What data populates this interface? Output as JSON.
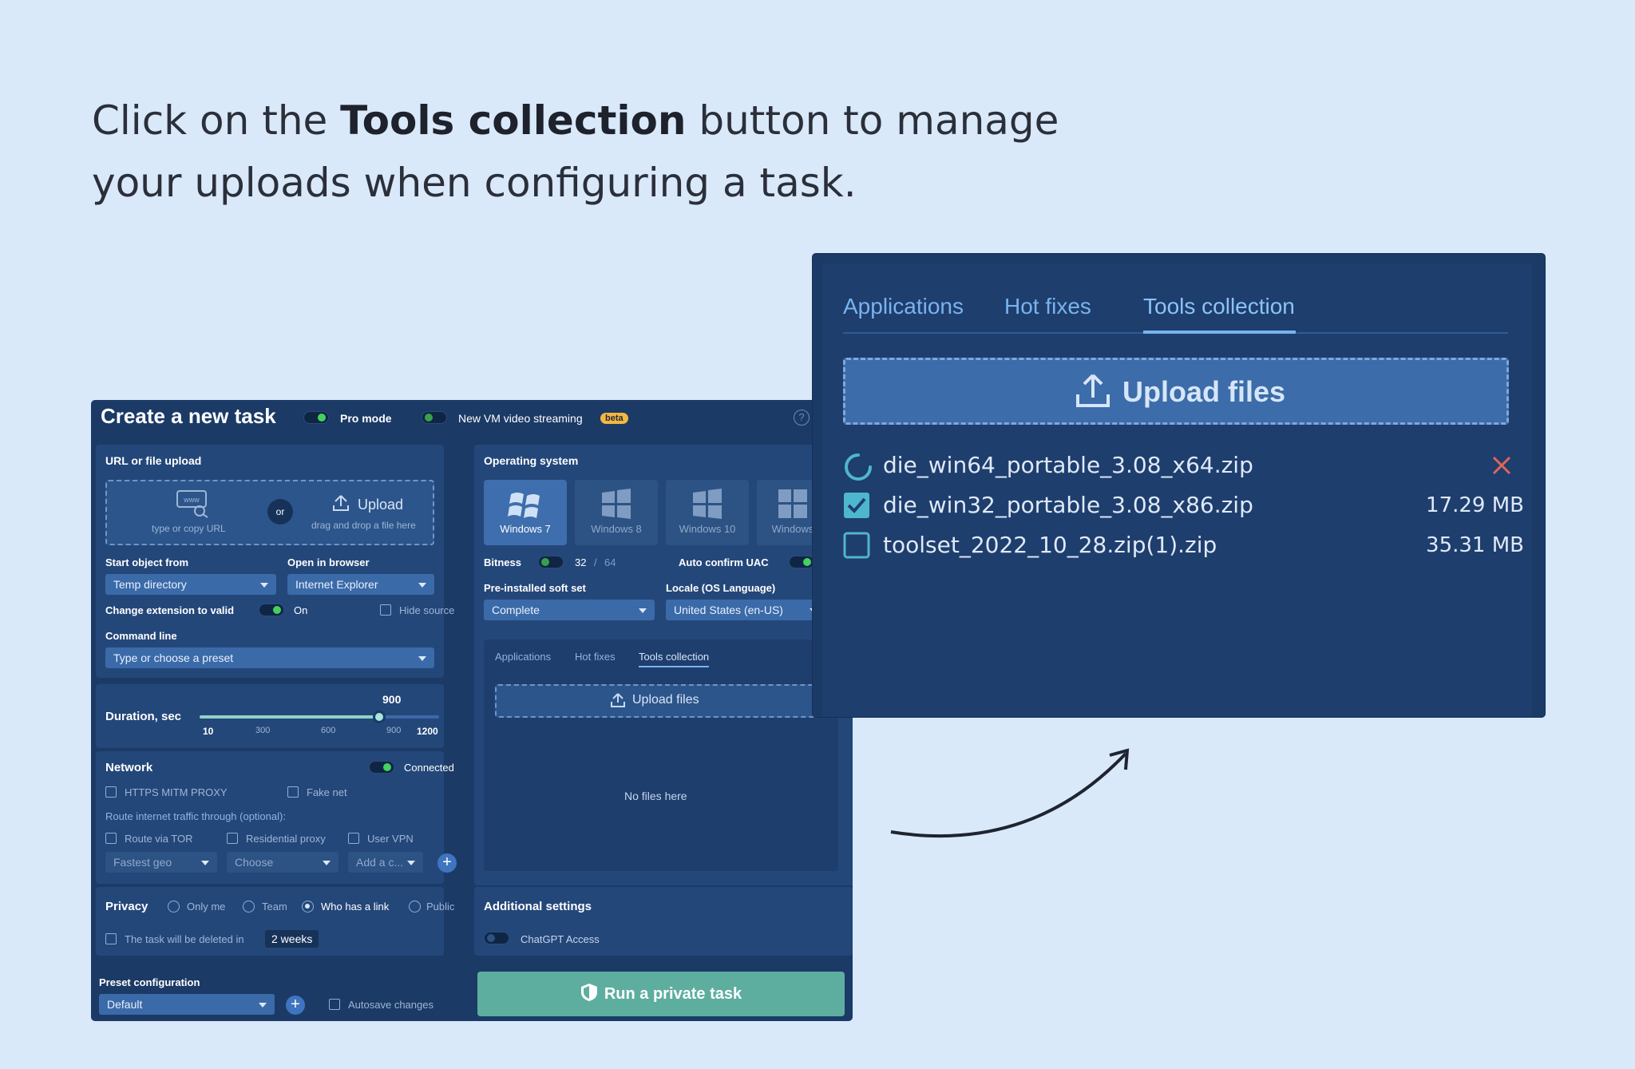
{
  "header": {
    "prefix": "Click on the ",
    "bold": "Tools collection",
    "line1_suffix": " button to manage",
    "line2": "your uploads when configuring a task."
  },
  "task": {
    "title": "Create a new task",
    "pro_mode": "Pro mode",
    "vm_streaming": "New VM video streaming",
    "beta": "beta",
    "help": "?"
  },
  "upload": {
    "section": "URL or file upload",
    "url_hint": "type or copy URL",
    "or": "or",
    "upload_label": "Upload",
    "upload_hint": "drag and drop a file here",
    "start_label": "Start object from",
    "start_value": "Temp directory",
    "browser_label": "Open in browser",
    "browser_value": "Internet Explorer",
    "change_ext": "Change extension to valid",
    "change_ext_state": "On",
    "hide_source": "Hide source",
    "cmd_label": "Command line",
    "cmd_placeholder": "Type or choose a preset"
  },
  "duration": {
    "label": "Duration, sec",
    "value": "900",
    "min": "10",
    "t1": "300",
    "t2": "600",
    "t3": "900",
    "max": "1200",
    "fraction": 0.75
  },
  "network": {
    "label": "Network",
    "status": "Connected",
    "https": "HTTPS MITM PROXY",
    "fakenet": "Fake net",
    "route": "Route internet traffic through (optional):",
    "tor": "Route via TOR",
    "residential": "Residential proxy",
    "vpn": "User VPN",
    "geo": "Fastest geo",
    "choose": "Choose",
    "add": "Add a c...",
    "plus": "+"
  },
  "privacy": {
    "label": "Privacy",
    "opts": [
      "Only me",
      "Team",
      "Who has a link",
      "Public"
    ],
    "delete": "The task will be deleted in",
    "delete_value": "2 weeks"
  },
  "preset": {
    "label": "Preset configuration",
    "value": "Default",
    "plus": "+",
    "autosave": "Autosave changes"
  },
  "os": {
    "label": "Operating system",
    "items": [
      "Windows 7",
      "Windows 8",
      "Windows 10",
      "Windows"
    ],
    "bitness": "Bitness",
    "bit32": "32",
    "sep": "/",
    "bit64": "64",
    "uac": "Auto confirm UAC",
    "softset_label": "Pre-installed soft set",
    "softset_value": "Complete",
    "locale_label": "Locale (OS Language)",
    "locale_value": "United States (en-US)"
  },
  "small_tabs": {
    "apps": "Applications",
    "hotfixes": "Hot fixes",
    "tools": "Tools collection",
    "upload": "Upload files",
    "empty": "No files here"
  },
  "additional": {
    "label": "Additional settings",
    "chatgpt": "ChatGPT Access"
  },
  "run": {
    "label": "Run a private task"
  },
  "big": {
    "tabs": [
      "Applications",
      "Hot fixes",
      "Tools collection"
    ],
    "upload": "Upload files",
    "files": [
      {
        "name": "die_win64_portable_3.08_x64.zip",
        "size": "",
        "state": "loading"
      },
      {
        "name": "die_win32_portable_3.08_x86.zip",
        "size": "17.29 MB",
        "state": "checked"
      },
      {
        "name": "toolset_2022_10_28.zip(1).zip",
        "size": "35.31 MB",
        "state": "unchecked"
      }
    ]
  },
  "colors": {
    "bg": "#d9e9fa",
    "panel": "#1b3a66",
    "accent": "#5eae9f",
    "tab_active": "#7ab3ee",
    "close": "#e0665a",
    "check": "#4fb6cf"
  }
}
